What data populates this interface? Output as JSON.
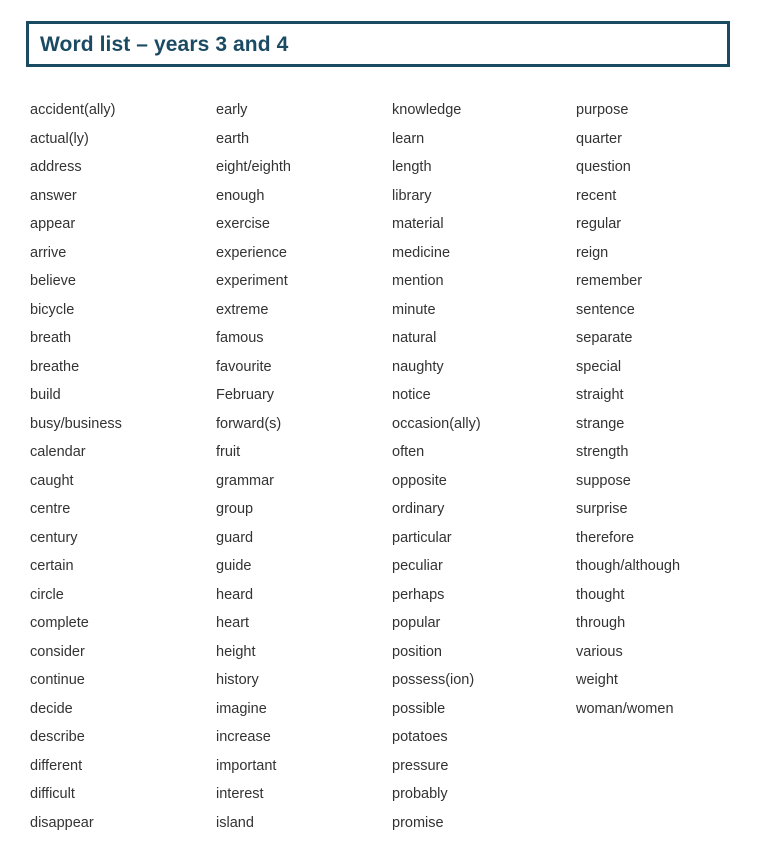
{
  "document": {
    "title": "Word list – years 3 and 4",
    "accent_color": "#1b4a63",
    "text_color": "#333333",
    "background_color": "#ffffff"
  },
  "word_columns": [
    {
      "column_name": "column-1",
      "words": [
        "accident(ally)",
        "actual(ly)",
        "address",
        "answer",
        "appear",
        "arrive",
        "believe",
        "bicycle",
        "breath",
        "breathe",
        "build",
        "busy/business",
        "calendar",
        "caught",
        "centre",
        "century",
        "certain",
        "circle",
        "complete",
        "consider",
        "continue",
        "decide",
        "describe",
        "different",
        "difficult",
        "disappear"
      ]
    },
    {
      "column_name": "column-2",
      "words": [
        "early",
        "earth",
        "eight/eighth",
        "enough",
        "exercise",
        "experience",
        "experiment",
        "extreme",
        "famous",
        "favourite",
        "February",
        "forward(s)",
        "fruit",
        "grammar",
        "group",
        "guard",
        "guide",
        "heard",
        "heart",
        "height",
        "history",
        "imagine",
        "increase",
        "important",
        "interest",
        "island"
      ]
    },
    {
      "column_name": "column-3",
      "words": [
        "knowledge",
        "learn",
        "length",
        "library",
        "material",
        "medicine",
        "mention",
        "minute",
        "natural",
        "naughty",
        "notice",
        "occasion(ally)",
        "often",
        "opposite",
        "ordinary",
        "particular",
        "peculiar",
        "perhaps",
        "popular",
        "position",
        "possess(ion)",
        "possible",
        "potatoes",
        "pressure",
        "probably",
        "promise"
      ]
    },
    {
      "column_name": "column-4",
      "words": [
        "purpose",
        "quarter",
        "question",
        "recent",
        "regular",
        "reign",
        "remember",
        "sentence",
        "separate",
        "special",
        "straight",
        "strange",
        "strength",
        "suppose",
        "surprise",
        "therefore",
        "though/although",
        "thought",
        "through",
        "various",
        "weight",
        "woman/women"
      ]
    }
  ]
}
